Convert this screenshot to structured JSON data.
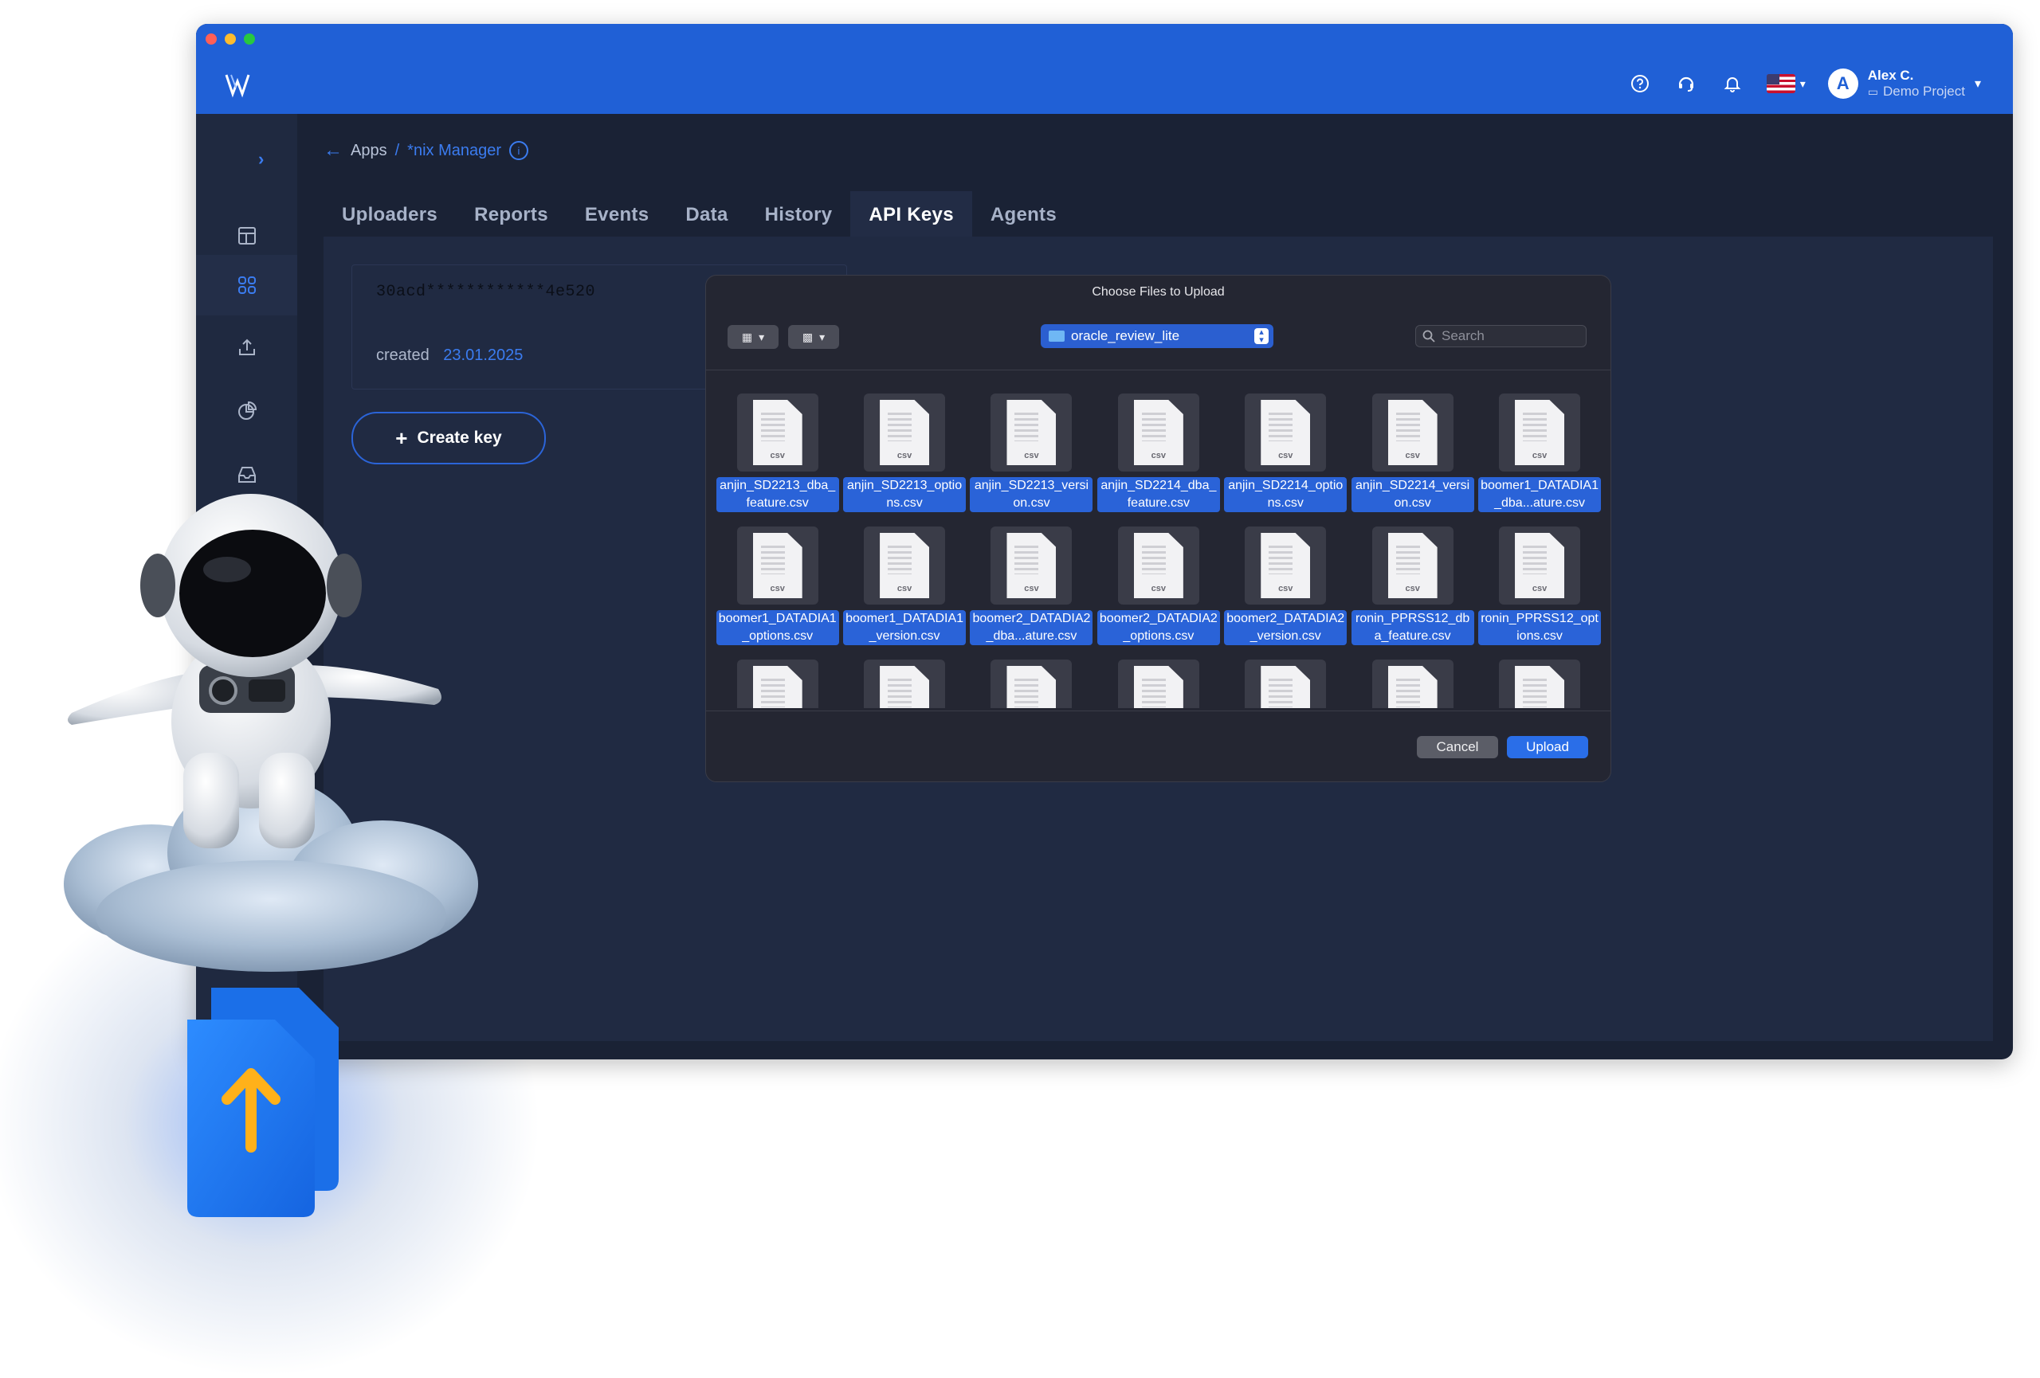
{
  "window": {
    "header": {
      "user_name": "Alex C.",
      "project": "Demo Project",
      "avatar_letter": "A",
      "icons": [
        "help-icon",
        "support-icon",
        "notification-bell-icon",
        "us-flag-icon",
        "chevron-down-icon"
      ]
    },
    "sidebar": {
      "items": [
        "dashboard-icon",
        "apps-grid-icon",
        "upload-icon",
        "reports-pie-icon",
        "inbox-icon"
      ],
      "active_index": 1
    },
    "breadcrumb": {
      "back": "←",
      "apps": "Apps",
      "separator": "/",
      "current": "*nix Manager",
      "info": "i"
    },
    "tabs": [
      "Uploaders",
      "Reports",
      "Events",
      "Data",
      "History",
      "API Keys",
      "Agents"
    ],
    "active_tab": "API Keys",
    "api_key": {
      "value": "30acd************4e520",
      "created_label": "created",
      "created_date": "23.01.2025"
    },
    "create_key_label": "Create key",
    "create_key_plus": "+"
  },
  "dialog": {
    "title": "Choose Files to Upload",
    "folder": "oracle_review_lite",
    "search_placeholder": "Search",
    "file_type_label": "csv",
    "files": [
      "anjin_SD2213_dba_feature.csv",
      "anjin_SD2213_options.csv",
      "anjin_SD2213_version.csv",
      "anjin_SD2214_dba_feature.csv",
      "anjin_SD2214_options.csv",
      "anjin_SD2214_version.csv",
      "boomer1_DATADIA1_dba...ature.csv",
      "boomer1_DATADIA1_options.csv",
      "boomer1_DATADIA1_version.csv",
      "boomer2_DATADIA2_dba...ature.csv",
      "boomer2_DATADIA2_options.csv",
      "boomer2_DATADIA2_version.csv",
      "ronin_PPRSS12_dba_feature.csv",
      "ronin_PPRSS12_options.csv"
    ],
    "cancel_label": "Cancel",
    "upload_label": "Upload"
  },
  "colors": {
    "header_blue": "#2060d6",
    "app_bg": "#1a2235",
    "accent": "#3b7cf0",
    "selection": "#2a63d8"
  }
}
